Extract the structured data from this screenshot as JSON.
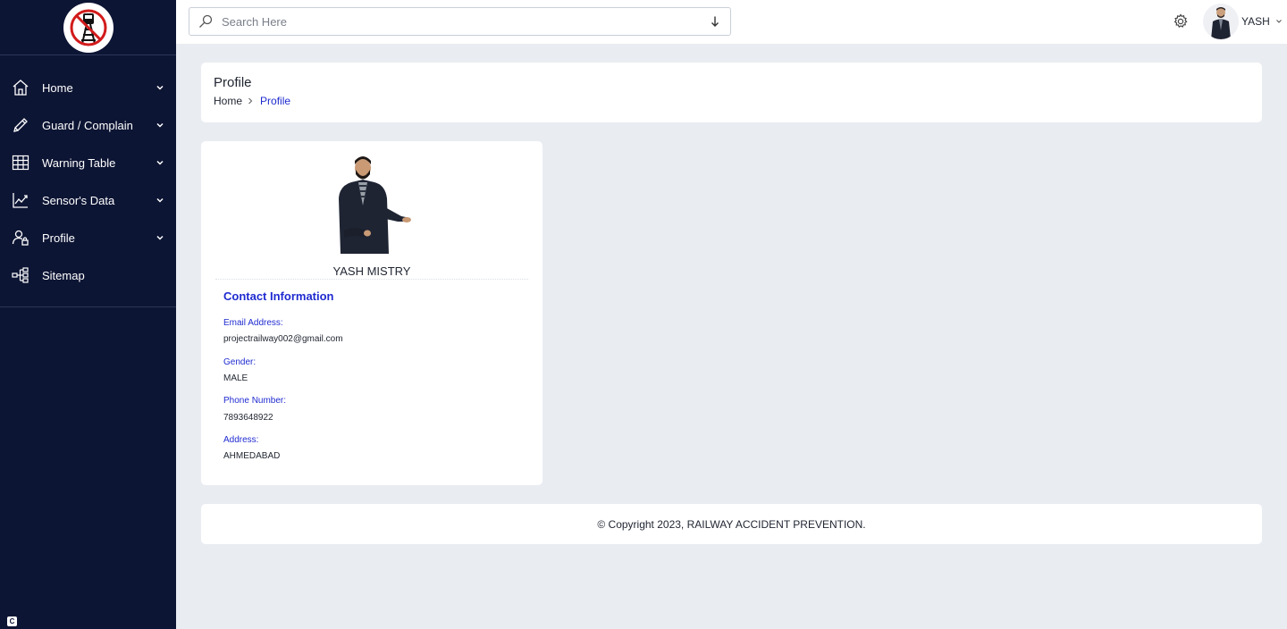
{
  "sidebar": {
    "logo_icon": "railway-prohibition-logo",
    "items": [
      {
        "label": "Home",
        "icon": "home-icon",
        "has_chevron": true
      },
      {
        "label": "Guard / Complain",
        "icon": "pencil-icon",
        "has_chevron": true
      },
      {
        "label": "Warning Table",
        "icon": "table-grid-icon",
        "has_chevron": true
      },
      {
        "label": "Sensor's Data",
        "icon": "line-chart-icon",
        "has_chevron": true
      },
      {
        "label": "Profile",
        "icon": "user-lock-icon",
        "has_chevron": true
      },
      {
        "label": "Sitemap",
        "icon": "sitemap-icon",
        "has_chevron": false
      }
    ],
    "badge": "C"
  },
  "topbar": {
    "search_placeholder": "Search Here",
    "user_name": "YASH"
  },
  "page_head": {
    "title": "Profile",
    "breadcrumb_home": "Home",
    "breadcrumb_current": "Profile"
  },
  "profile": {
    "name": "YASH MISTRY",
    "contact_title": "Contact Information",
    "fields": [
      {
        "label": "Email Address:",
        "value": "projectrailway002@gmail.com"
      },
      {
        "label": "Gender:",
        "value": "MALE"
      },
      {
        "label": "Phone Number:",
        "value": "7893648922"
      },
      {
        "label": "Address:",
        "value": "AHMEDABAD"
      }
    ]
  },
  "footer": {
    "text": "© Copyright 2023, RAILWAY ACCIDENT PREVENTION."
  },
  "colors": {
    "sidebar_bg": "#0d1534",
    "accent": "#1f2bd0",
    "page_bg": "#e9ecf1"
  }
}
